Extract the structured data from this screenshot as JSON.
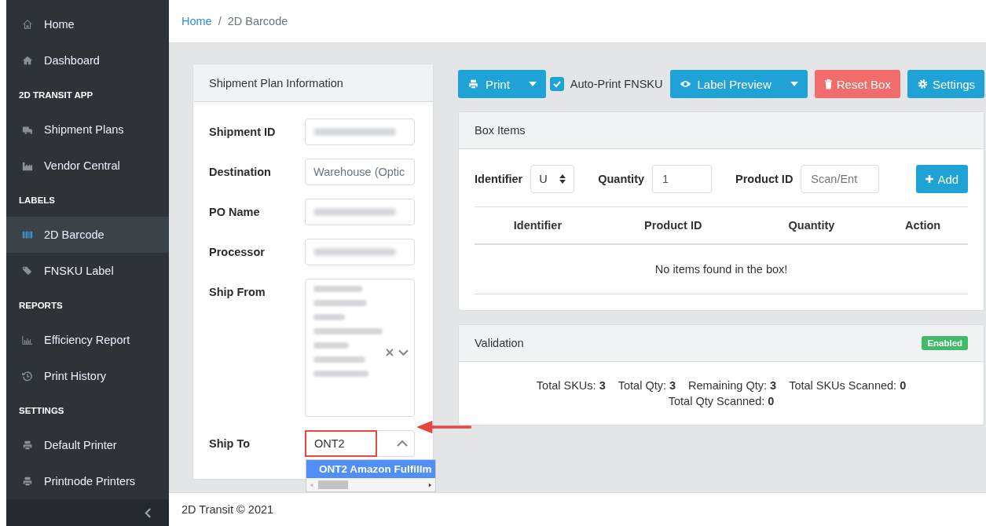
{
  "sidebar": {
    "items": [
      {
        "kind": "link",
        "label": "Home",
        "selected": false
      },
      {
        "kind": "link",
        "label": "Dashboard",
        "selected": false
      },
      {
        "kind": "header",
        "label": "2D TRANSIT APP"
      },
      {
        "kind": "link",
        "label": "Shipment Plans",
        "selected": false
      },
      {
        "kind": "link",
        "label": "Vendor Central",
        "selected": false
      },
      {
        "kind": "header",
        "label": "LABELS"
      },
      {
        "kind": "link",
        "label": "2D Barcode",
        "selected": true
      },
      {
        "kind": "link",
        "label": "FNSKU Label",
        "selected": false
      },
      {
        "kind": "header",
        "label": "REPORTS"
      },
      {
        "kind": "link",
        "label": "Efficiency Report",
        "selected": false
      },
      {
        "kind": "link",
        "label": "Print History",
        "selected": false
      },
      {
        "kind": "header",
        "label": "SETTINGS"
      },
      {
        "kind": "link",
        "label": "Default Printer",
        "selected": false
      },
      {
        "kind": "link",
        "label": "Printnode Printers",
        "selected": false
      }
    ]
  },
  "breadcrumb": [
    "Home",
    "/",
    "2D Barcode"
  ],
  "shipment_plan": {
    "title": "Shipment Plan Information",
    "fields": [
      {
        "label": "Shipment ID",
        "kind": "blurred"
      },
      {
        "label": "Destination",
        "kind": "text",
        "placeholder": "Warehouse (Optic"
      },
      {
        "label": "PO Name",
        "kind": "blurred"
      },
      {
        "label": "Processor",
        "kind": "blurred"
      },
      {
        "label": "Ship From",
        "kind": "select-blurred"
      },
      {
        "label": "Ship To",
        "kind": "combobox",
        "value": "ONT2",
        "options": [
          {
            "label": "ONT2 Amazon Fulfillm",
            "selected": true
          }
        ]
      }
    ]
  },
  "toolbar": [
    {
      "kind": "split",
      "label": "Print"
    },
    {
      "kind": "checkbox",
      "label": "Auto-Print FNSKU",
      "checked": true
    },
    {
      "kind": "split",
      "label": "Label Preview"
    },
    {
      "kind": "danger",
      "label": "Reset Box"
    },
    {
      "kind": "primary",
      "label": "Settings"
    }
  ],
  "box_items": {
    "title": "Box Items",
    "identifier": {
      "label": "Identifier",
      "value": "U"
    },
    "quantity": {
      "label": "Quantity",
      "value": "1"
    },
    "product_id": {
      "label": "Product ID",
      "placeholder": "Scan/Ent"
    },
    "add_button": "Add",
    "columns": [
      "Identifier",
      "Product ID",
      "Quantity",
      "Action"
    ],
    "empty_message": "No items found in the box!"
  },
  "validation": {
    "title": "Validation",
    "badge": "Enabled",
    "stats": [
      "Total SKUs: **3**",
      "Total Qty: **3**",
      "Remaining Qty: **3**",
      "Total SKUs Scanned: **0**",
      "Total Qty Scanned: **0**"
    ]
  },
  "footer": "2D Transit © 2021"
}
